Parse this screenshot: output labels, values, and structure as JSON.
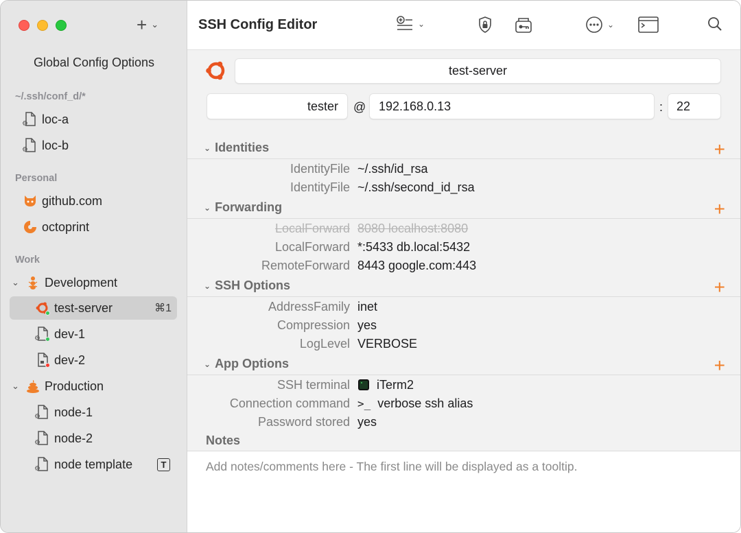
{
  "app": {
    "title": "SSH Config Editor"
  },
  "sidebar": {
    "global": "Global Config Options",
    "sections": [
      {
        "label": "~/.ssh/conf_d/*"
      },
      {
        "label": "Personal"
      },
      {
        "label": "Work"
      }
    ],
    "items": {
      "loc_a": "loc-a",
      "loc_b": "loc-b",
      "github": "github.com",
      "octoprint": "octoprint",
      "development": "Development",
      "test_server": "test-server",
      "test_server_shortcut": "⌘1",
      "dev1": "dev-1",
      "dev2": "dev-2",
      "production": "Production",
      "node1": "node-1",
      "node2": "node-2",
      "node_template": "node template",
      "template_badge": "T"
    }
  },
  "host": {
    "name": "test-server",
    "user": "tester",
    "at": "@",
    "hostname": "192.168.0.13",
    "colon": ":",
    "port": "22"
  },
  "sections": {
    "identities": {
      "title": "Identities",
      "rows": [
        {
          "key": "IdentityFile",
          "value": "~/.ssh/id_rsa"
        },
        {
          "key": "IdentityFile",
          "value": "~/.ssh/second_id_rsa"
        }
      ]
    },
    "forwarding": {
      "title": "Forwarding",
      "rows": [
        {
          "key": "LocalForward",
          "value": "8080 localhost:8080",
          "disabled": true
        },
        {
          "key": "LocalForward",
          "value": "*:5433 db.local:5432"
        },
        {
          "key": "RemoteForward",
          "value": "8443 google.com:443"
        }
      ]
    },
    "ssh_options": {
      "title": "SSH Options",
      "rows": [
        {
          "key": "AddressFamily",
          "value": "inet"
        },
        {
          "key": "Compression",
          "value": "yes"
        },
        {
          "key": "LogLevel",
          "value": "VERBOSE"
        }
      ]
    },
    "app_options": {
      "title": "App Options",
      "rows": [
        {
          "key": "SSH terminal",
          "value": "iTerm2",
          "icon": "iterm-icon"
        },
        {
          "key": "Connection command",
          "value": "verbose ssh alias",
          "icon": "terminal-prompt-icon",
          "prefix": ">_"
        },
        {
          "key": "Password stored",
          "value": "yes"
        }
      ]
    }
  },
  "notes": {
    "title": "Notes",
    "placeholder": "Add notes/comments here - The first line will be displayed as a tooltip."
  },
  "colors": {
    "accent": "#f0802b",
    "sidebar_bg": "#e6e6e6",
    "selected_bg": "#d0d0d0",
    "ubuntu": "#e95420"
  }
}
